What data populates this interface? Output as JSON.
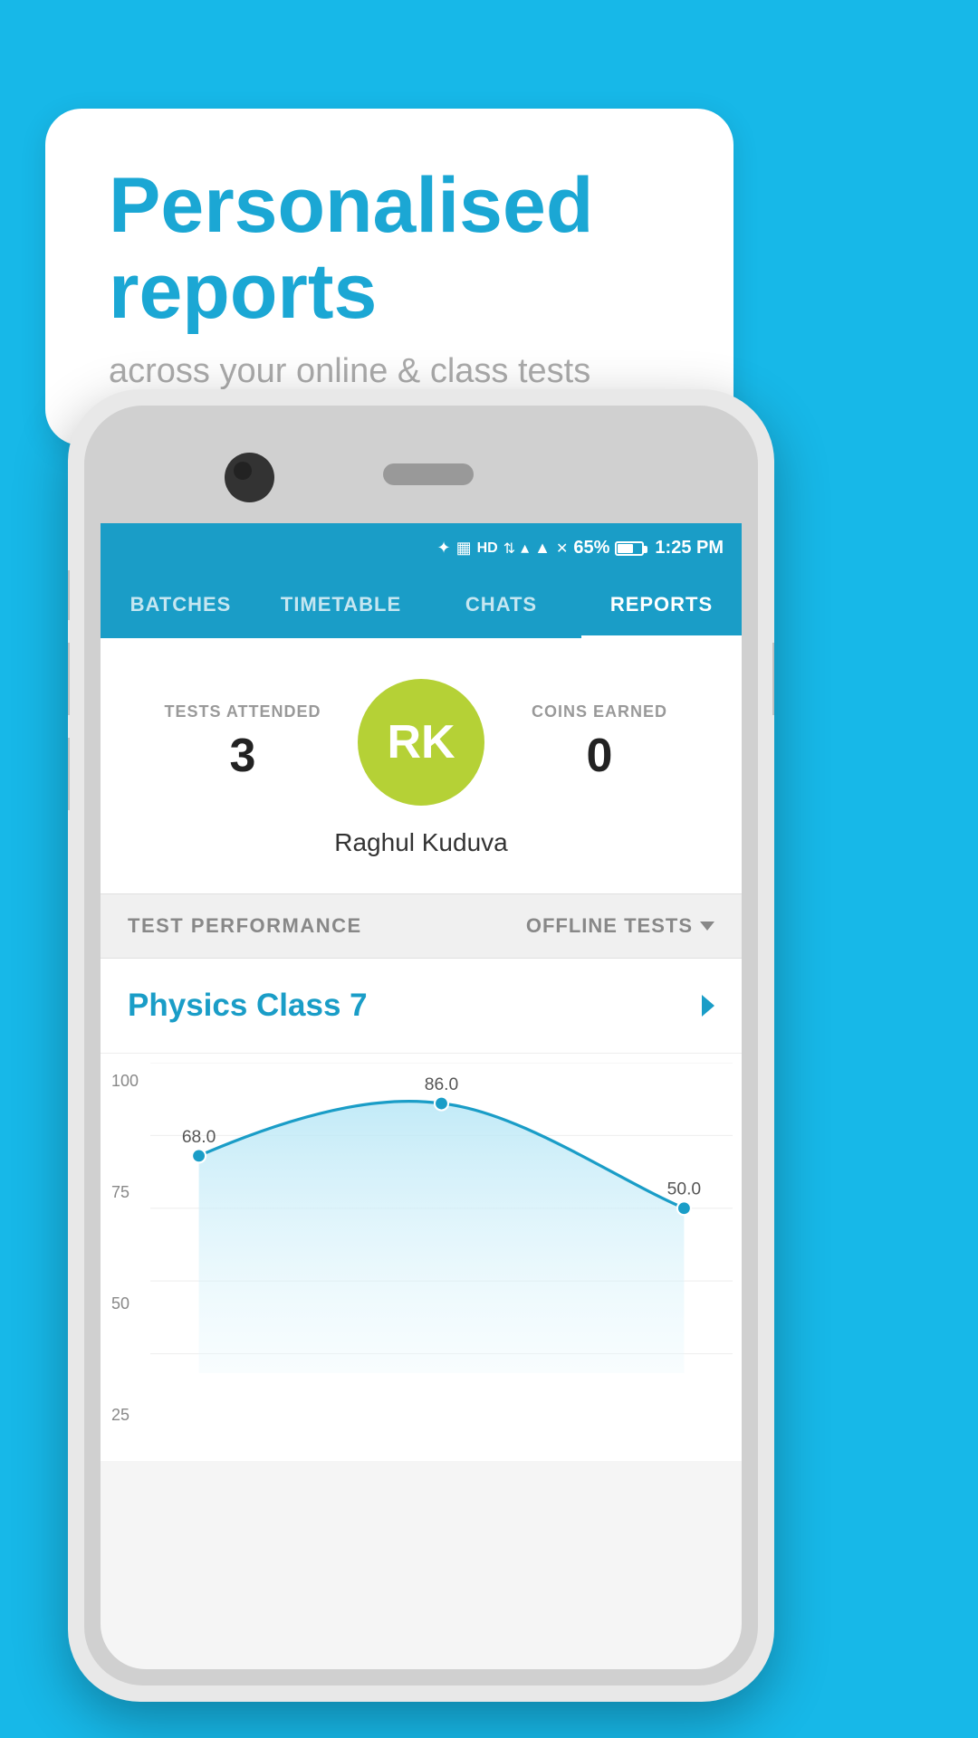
{
  "page": {
    "background_color": "#17b8e8"
  },
  "bubble": {
    "title": "Personalised reports",
    "subtitle": "across your online & class tests"
  },
  "status_bar": {
    "battery_percent": "65%",
    "time": "1:25 PM",
    "icons": [
      "bluetooth",
      "vibrate",
      "hd",
      "wifi",
      "signal",
      "x-signal"
    ]
  },
  "nav": {
    "tabs": [
      {
        "label": "BATCHES",
        "active": false
      },
      {
        "label": "TIMETABLE",
        "active": false
      },
      {
        "label": "CHATS",
        "active": false
      },
      {
        "label": "REPORTS",
        "active": true
      }
    ]
  },
  "profile": {
    "avatar_initials": "RK",
    "name": "Raghul Kuduva",
    "tests_attended_label": "TESTS ATTENDED",
    "tests_attended_value": "3",
    "coins_earned_label": "COINS EARNED",
    "coins_earned_value": "0"
  },
  "test_performance": {
    "section_label": "TEST PERFORMANCE",
    "filter_label": "OFFLINE TESTS",
    "class_name": "Physics Class 7"
  },
  "chart": {
    "y_labels": [
      "100",
      "75",
      "50",
      "25"
    ],
    "data_points": [
      {
        "x": 0,
        "y": 68.0,
        "label": "68.0"
      },
      {
        "x": 1,
        "y": 86.0,
        "label": "86.0"
      },
      {
        "x": 2,
        "y": 50.0,
        "label": "50.0"
      }
    ],
    "y_min": 0,
    "y_max": 100
  }
}
